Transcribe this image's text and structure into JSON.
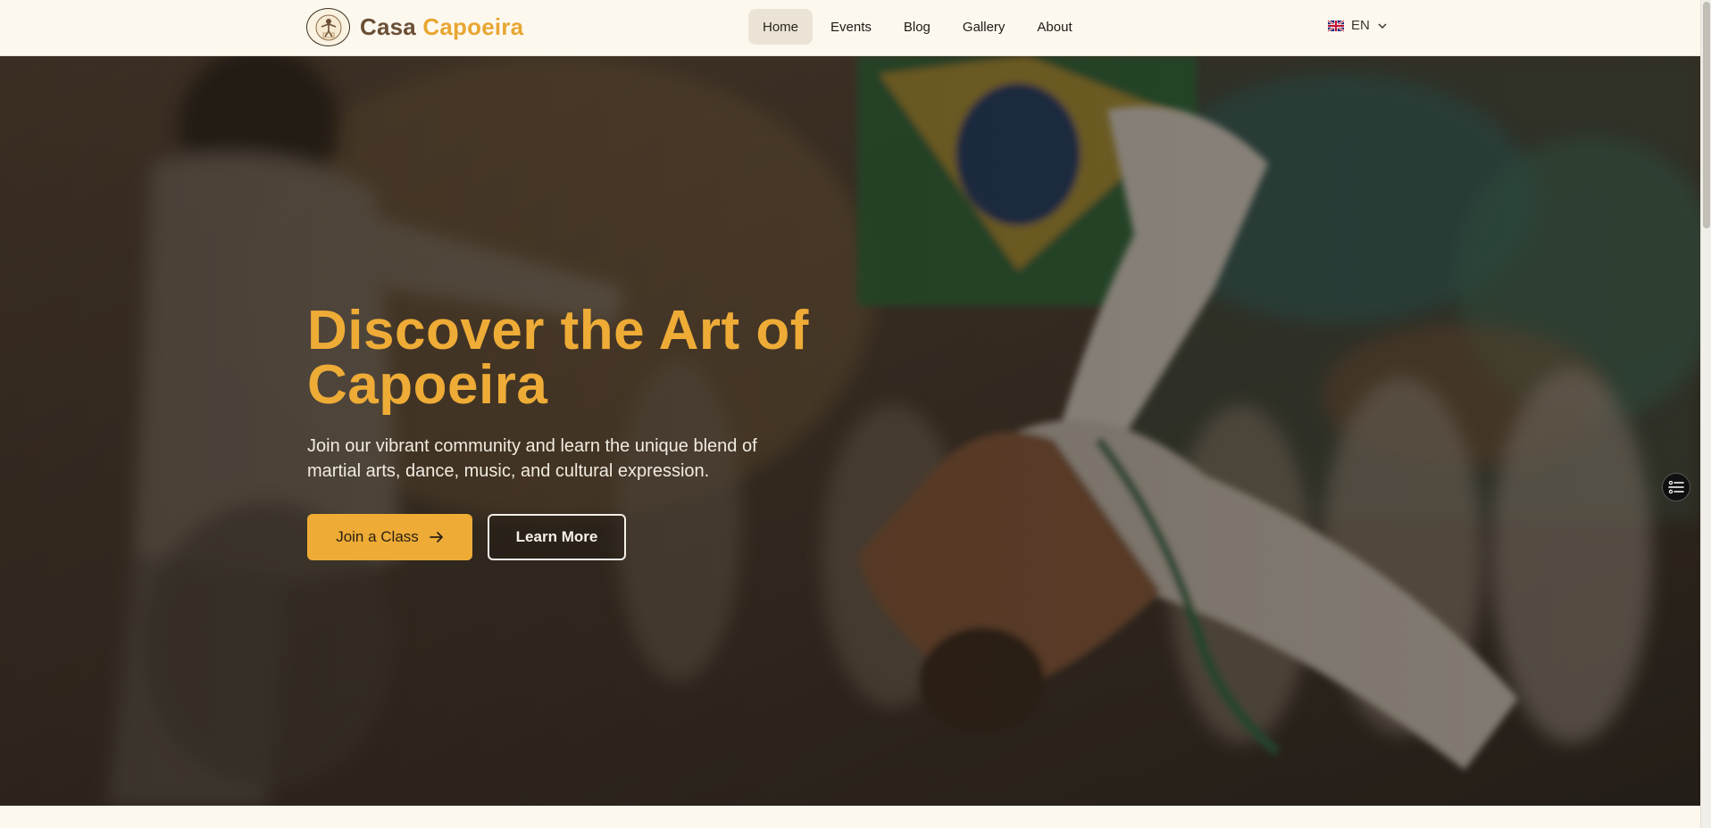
{
  "header": {
    "brand_word1": "Casa",
    "brand_word2": "Capoeira",
    "nav": [
      {
        "label": "Home",
        "active": true
      },
      {
        "label": "Events",
        "active": false
      },
      {
        "label": "Blog",
        "active": false
      },
      {
        "label": "Gallery",
        "active": false
      },
      {
        "label": "About",
        "active": false
      }
    ],
    "language": {
      "code": "EN",
      "flag_icon": "uk-flag-icon"
    }
  },
  "hero": {
    "title": "Discover the Art of Capoeira",
    "subtitle": "Join our vibrant community and learn the unique blend of martial arts, dance, music, and cultural expression.",
    "primary_button": "Join a Class",
    "secondary_button": "Learn More"
  },
  "colors": {
    "accent": "#eeac37",
    "brand_dark": "#6b4f35",
    "page_bg": "#fdf8ee"
  }
}
